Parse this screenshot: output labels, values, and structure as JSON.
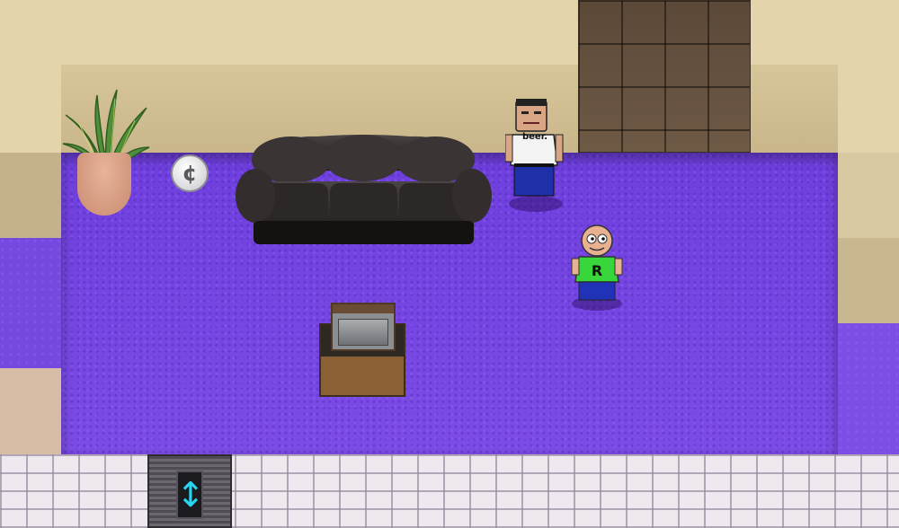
{
  "scene": {
    "npc": {
      "shirt_text": "beer."
    },
    "player": {
      "shirt_letter": "R"
    },
    "coin": {
      "symbol": "¢"
    },
    "elevator": {
      "icon": "up-down-arrow-icon",
      "symbol": "↕"
    }
  },
  "colors": {
    "carpet": "#7548e0",
    "wall": "#e4d4ac",
    "player_shirt": "#39d63b",
    "elevator_arrow": "#2ad4f0"
  }
}
